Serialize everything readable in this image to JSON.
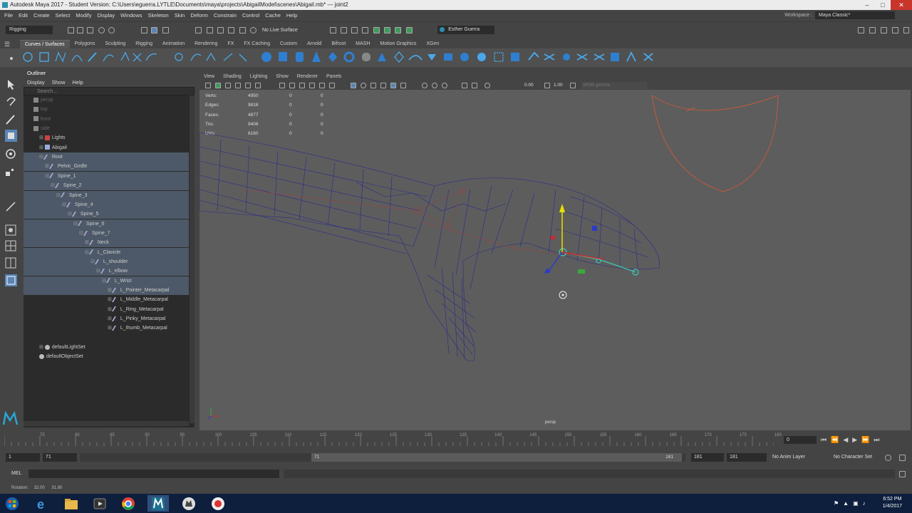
{
  "title_bar": {
    "title": "Autodesk Maya 2017 - Student Version: C:\\Users\\eguerra.LYTLE\\Documents\\maya\\projects\\AbigailModel\\scenes\\Abigail.mb*  ---  joint2",
    "minimize": "–",
    "maximize": "□",
    "close": "✕"
  },
  "menu": [
    "File",
    "Edit",
    "Create",
    "Select",
    "Modify",
    "Display",
    "Windows",
    "Skeleton",
    "Skin",
    "Deform",
    "Constrain",
    "Control",
    "Cache",
    "Help"
  ],
  "workspace": {
    "label": "Workspace :",
    "value": "Maya Classic*"
  },
  "status_line": {
    "menu_set": "Rigging",
    "live_surface": "No Live Surface",
    "user": "Esther Guerra"
  },
  "shelf_tabs": [
    "Curves / Surfaces",
    "Polygons",
    "Sculpting",
    "Rigging",
    "Animation",
    "Rendering",
    "FX",
    "FX Caching",
    "Custom",
    "Arnold",
    "Bifrost",
    "MASH",
    "Motion Graphics",
    "XGen"
  ],
  "shelf_active": "Curves / Surfaces",
  "outliner": {
    "title": "Outliner",
    "menu": [
      "Display",
      "Show",
      "Help"
    ],
    "search_placeholder": "Search...",
    "rows": [
      {
        "label": "persp",
        "indent": 0,
        "kind": "camera",
        "dim": true
      },
      {
        "label": "top",
        "indent": 0,
        "kind": "camera",
        "dim": true
      },
      {
        "label": "front",
        "indent": 0,
        "kind": "camera",
        "dim": true
      },
      {
        "label": "side",
        "indent": 0,
        "kind": "camera",
        "dim": true
      },
      {
        "label": "Lights",
        "indent": 1,
        "kind": "group",
        "expand": "+"
      },
      {
        "label": "Abigail",
        "indent": 1,
        "kind": "mesh",
        "expand": "+"
      },
      {
        "label": "Root",
        "indent": 1,
        "kind": "joint",
        "expand": "-",
        "sel": true
      },
      {
        "label": "Pelvic_Girdle",
        "indent": 2,
        "kind": "joint",
        "expand": "+",
        "sel": true
      },
      {
        "label": "Spine_1",
        "indent": 2,
        "kind": "joint",
        "expand": "-",
        "sel": true
      },
      {
        "label": "Spine_2",
        "indent": 3,
        "kind": "joint",
        "expand": "-",
        "sel": true
      },
      {
        "label": "Spine_3",
        "indent": 4,
        "kind": "joint",
        "expand": "-",
        "sel": true
      },
      {
        "label": "Spine_4",
        "indent": 5,
        "kind": "joint",
        "expand": "-",
        "sel": true
      },
      {
        "label": "Spine_5",
        "indent": 6,
        "kind": "joint",
        "expand": "-",
        "sel": true
      },
      {
        "label": "Spine_6",
        "indent": 7,
        "kind": "joint",
        "expand": "-",
        "sel": true
      },
      {
        "label": "Spine_7",
        "indent": 8,
        "kind": "joint",
        "expand": "-",
        "sel": true
      },
      {
        "label": "Neck",
        "indent": 9,
        "kind": "joint",
        "expand": "+",
        "sel": true
      },
      {
        "label": "L_Clavicle",
        "indent": 9,
        "kind": "joint",
        "expand": "-",
        "sel": true
      },
      {
        "label": "L_shoulder",
        "indent": 10,
        "kind": "joint",
        "expand": "-",
        "sel": true
      },
      {
        "label": "L_elbow",
        "indent": 11,
        "kind": "joint",
        "expand": "-",
        "sel": true
      },
      {
        "label": "L_Wrist",
        "indent": 12,
        "kind": "joint",
        "expand": "-",
        "sel": true
      },
      {
        "label": "L_Pointer_Metacarpal",
        "indent": 13,
        "kind": "joint",
        "expand": "+",
        "sel": true
      },
      {
        "label": "L_Middle_Metacarpal",
        "indent": 13,
        "kind": "joint",
        "expand": "+"
      },
      {
        "label": "L_Ring_Metacarpal",
        "indent": 13,
        "kind": "joint",
        "expand": "+"
      },
      {
        "label": "L_Pinky_Metacarpal",
        "indent": 13,
        "kind": "joint",
        "expand": "+"
      },
      {
        "label": "L_thumb_Metacarpal",
        "indent": 13,
        "kind": "joint",
        "expand": "+"
      },
      {
        "label": "",
        "indent": 0,
        "kind": "blank"
      },
      {
        "label": "defaultLightSet",
        "indent": 1,
        "kind": "set",
        "expand": "+"
      },
      {
        "label": "defaultObjectSet",
        "indent": 1,
        "kind": "set"
      }
    ]
  },
  "viewport": {
    "menu": [
      "View",
      "Shading",
      "Lighting",
      "Show",
      "Renderer",
      "Panels"
    ],
    "toolbar_value_1": "0.00",
    "toolbar_value_2": "1.00",
    "colorspace": "sRGB gamma",
    "camera_label": "persp",
    "hud": [
      {
        "label": "Verts:",
        "a": "4950",
        "b": "0",
        "c": "0"
      },
      {
        "label": "Edges:",
        "a": "9818",
        "b": "0",
        "c": "0"
      },
      {
        "label": "Faces:",
        "a": "4877",
        "b": "0",
        "c": "0"
      },
      {
        "label": "Tris:",
        "a": "9406",
        "b": "0",
        "c": "0"
      },
      {
        "label": "UVs:",
        "a": "6160",
        "b": "0",
        "c": "0"
      }
    ]
  },
  "time_slider": {
    "ticks": [
      "75",
      "80",
      "85",
      "90",
      "95",
      "100",
      "105",
      "110",
      "115",
      "120",
      "125",
      "130",
      "135",
      "140",
      "145",
      "150",
      "155",
      "160",
      "165",
      "170",
      "175",
      "180"
    ],
    "current_frame": "0"
  },
  "range_slider": {
    "start": "1",
    "range_start": "71",
    "range_label_left": "71",
    "range_label_right": "181",
    "range_end": "181",
    "end": "181",
    "anim_layer": "No Anim Layer",
    "char_set": "No Character Set"
  },
  "command_line": {
    "lang": "MEL"
  },
  "help_line": {
    "label": "Rotation:",
    "value1": "32.00",
    "value2": "31.80"
  },
  "taskbar": {
    "time": "6:52 PM",
    "date": "1/4/2017"
  },
  "colors": {
    "selection": "#4d5968",
    "wire": "#2a2a8c",
    "accent": "#2d8fae"
  }
}
